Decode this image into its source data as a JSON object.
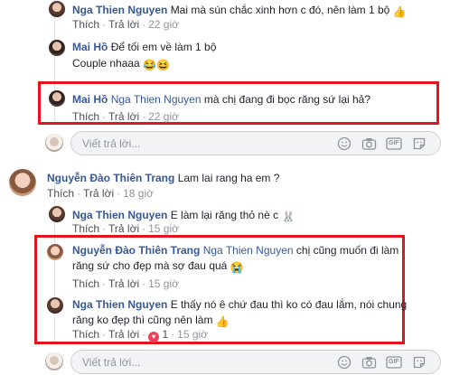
{
  "comments": [
    {
      "name": "Nga Thien Nguyen",
      "tag": "",
      "text": "Mai mà sún chắc xinh hơn c đó, nên làm 1 bộ",
      "emoji": "👍",
      "like": "Thích",
      "reply": "Trả lời",
      "time": "22 giờ"
    },
    {
      "name": "Mai Hồ",
      "tag": "",
      "text": "Để tối em về làm 1 bộ",
      "text2": "Couple nhaaa",
      "emoji": "😂😆",
      "like": "",
      "reply": "",
      "time": ""
    },
    {
      "name": "Mai Hồ",
      "tag": "Nga Thien Nguyen",
      "text": "mà chị đang đi bọc răng sứ lại hả?",
      "like": "Thích",
      "reply": "Trả lời",
      "time": "22 giờ"
    },
    {
      "name": "Nguyễn Đào Thiên Trang",
      "tag": "",
      "text": "Lam lai rang ha em ?",
      "like": "Thích",
      "reply": "Trả lời",
      "time": "18 giờ"
    },
    {
      "name": "Nga Thien Nguyen",
      "tag": "",
      "text": "E làm lại răng thỏ nè c",
      "emoji": "🐰",
      "like": "Thích",
      "reply": "Trả lời",
      "time": "15 giờ"
    },
    {
      "name": "Nguyễn Đào Thiên Trang",
      "tag": "Nga Thien Nguyen",
      "text": "chị cũng muốn đi làm",
      "text2": "răng sứ cho đẹp mà sợ đau quá",
      "emoji": "😭",
      "like": "Thích",
      "reply": "Trả lời",
      "time": "15 giờ"
    },
    {
      "name": "Nga Thien Nguyen",
      "tag": "",
      "text": "E thấy nó ê chứ đau thì ko có đau lắm, nói chung",
      "text2": "răng ko đẹp thì cũng nên làm",
      "emoji": "👍",
      "like": "Thích",
      "reply": "Trả lời",
      "reaction_count": "1",
      "time": "15 giờ"
    }
  ],
  "reply_placeholder": "Viết trả lời...",
  "reply_tools": [
    "smiley-icon",
    "camera-icon",
    "gif-icon",
    "sticker-icon"
  ],
  "gif_label": "GIF",
  "colors": {
    "name": "#365899",
    "highlight_border": "#e3141e",
    "meta": "#90949c"
  }
}
